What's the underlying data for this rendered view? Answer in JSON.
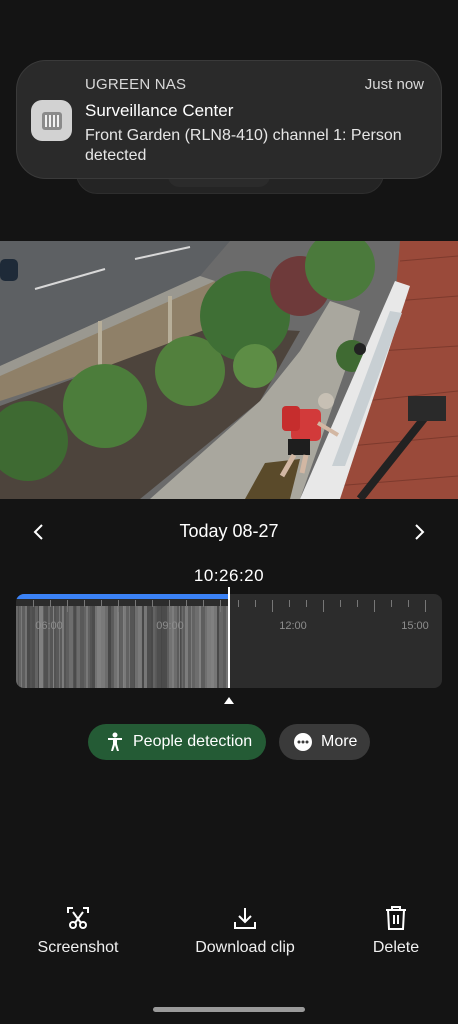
{
  "notification": {
    "app_name": "UGREEN NAS",
    "time": "Just now",
    "title": "Surveillance Center",
    "body": "Front Garden (RLN8-410) channel 1: Person detected",
    "icon": "nas-app-icon"
  },
  "camera": {
    "timestamp_overlay": "",
    "description_icon": "camera-feed"
  },
  "date_nav": {
    "prev_icon": "chevron-left-icon",
    "date": "Today 08-27",
    "next_icon": "chevron-right-icon"
  },
  "timeline": {
    "current_time": "10:26:20",
    "tick_labels": [
      "06:00",
      "09:00",
      "12:00",
      "15:00"
    ],
    "progress_fraction": 0.5,
    "colors": {
      "progress": "#3b82f6",
      "background": "#2c2c2c"
    }
  },
  "chips": {
    "people_detection": "People detection",
    "more": "More",
    "people_color": "#245b35"
  },
  "actions": {
    "screenshot": "Screenshot",
    "download_clip": "Download clip",
    "delete": "Delete"
  }
}
